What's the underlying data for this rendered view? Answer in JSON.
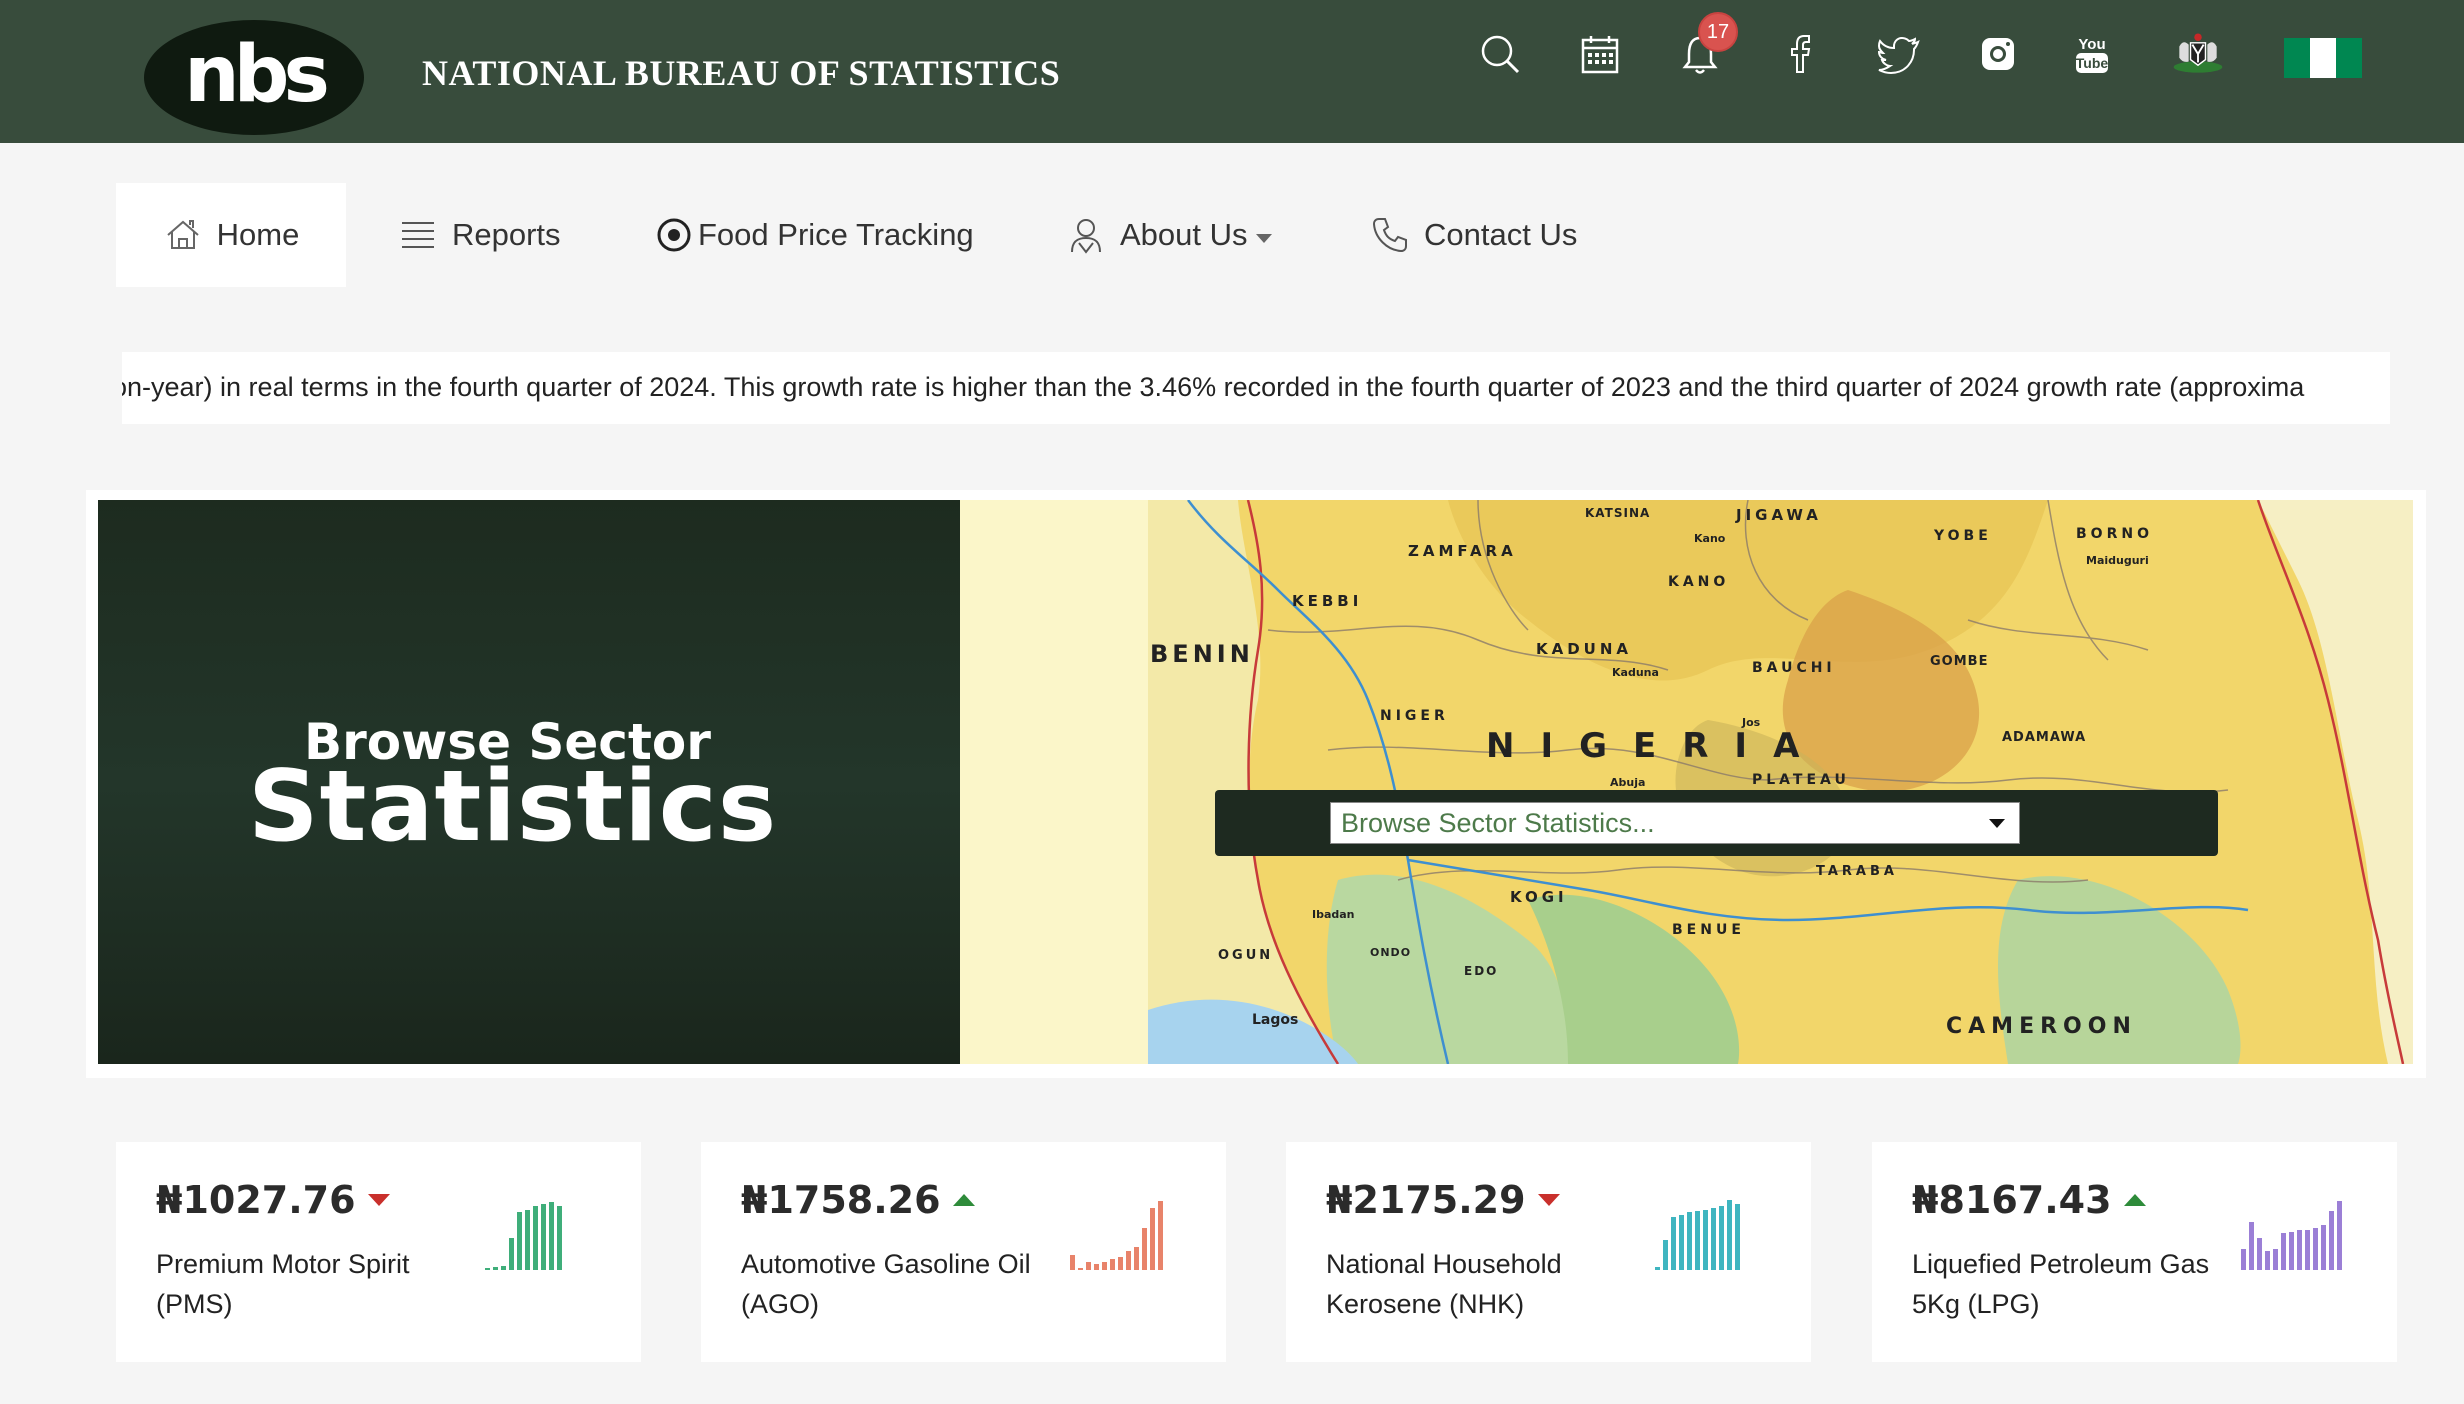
{
  "header": {
    "logo_text": "nbs",
    "title": "NATIONAL BUREAU OF STATISTICS",
    "icons": [
      "search-icon",
      "calendar-icon",
      "bell-icon",
      "facebook-icon",
      "twitter-icon",
      "instagram-icon",
      "youtube-icon",
      "coat-of-arms-icon",
      "nigeria-flag-icon"
    ],
    "notification_count": "17",
    "colors": {
      "background": "#384c3c",
      "badge": "#d9534f"
    }
  },
  "nav": {
    "items": [
      {
        "label": "Home",
        "icon": "home-icon",
        "active": true
      },
      {
        "label": "Reports",
        "icon": "list-icon"
      },
      {
        "label": "Food Price Tracking",
        "icon": "radio-icon"
      },
      {
        "label": "About Us",
        "icon": "user-icon",
        "dropdown": true
      },
      {
        "label": "Contact Us",
        "icon": "phone-icon"
      }
    ]
  },
  "ticker": {
    "text": "on-year) in real terms in the fourth quarter of 2024. This growth rate is higher than the 3.46% recorded in the fourth quarter of 2023 and the third quarter of 2024 growth rate (approxima"
  },
  "banner": {
    "subtitle": "Browse Sector",
    "title": "Statistics",
    "select_value": "Browse Sector Statistics...",
    "map_labels": [
      "BENIN",
      "NIGERIA",
      "CAMEROON",
      "ZAMFARA",
      "KATSINA",
      "JIGAWA",
      "YOBE",
      "BORNO",
      "KEBBI",
      "KANO",
      "KADUNA",
      "BAUCHI",
      "GOMBE",
      "NIGER",
      "ADAMAWA",
      "PLATEAU",
      "TARABA",
      "KOGI",
      "BENUE",
      "OGUN",
      "ONDO",
      "EDO",
      "Lagos",
      "Kano",
      "Kaduna",
      "Abuja",
      "Ibadan",
      "Maiduguri",
      "Jos"
    ]
  },
  "prices": [
    {
      "price": "₦1027.76",
      "trend": "down",
      "name": "Premium Motor Spirit (PMS)",
      "color": "#3fae7a",
      "spark": [
        2,
        3,
        4,
        30,
        55,
        57,
        60,
        62,
        64,
        60
      ]
    },
    {
      "price": "₦1758.26",
      "trend": "up",
      "name": "Automotive Gasoline Oil (AGO)",
      "color": "#e8836a",
      "spark": [
        14,
        2,
        8,
        6,
        8,
        10,
        12,
        18,
        22,
        40,
        58,
        65
      ]
    },
    {
      "price": "₦2175.29",
      "trend": "down",
      "name": "National Household Kerosene (NHK)",
      "color": "#3fb5c0",
      "spark": [
        3,
        28,
        50,
        52,
        55,
        56,
        57,
        58,
        60,
        66,
        62
      ]
    },
    {
      "price": "₦8167.43",
      "trend": "up",
      "name": "Liquefied Petroleum Gas 5Kg (LPG)",
      "color": "#9b7fd6",
      "spark": [
        20,
        45,
        30,
        18,
        20,
        35,
        36,
        38,
        38,
        40,
        42,
        56,
        65
      ]
    }
  ]
}
